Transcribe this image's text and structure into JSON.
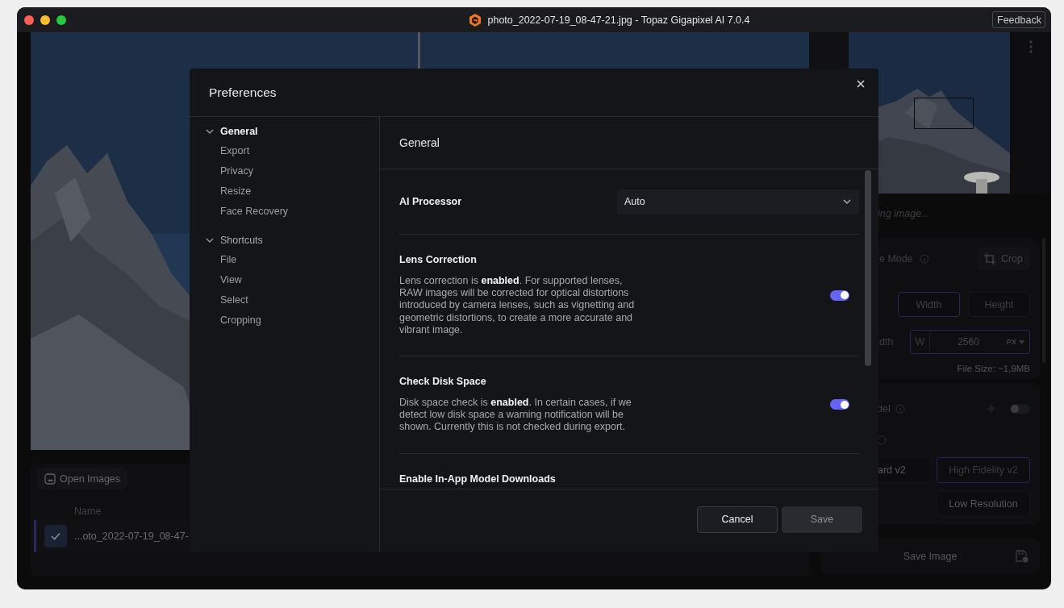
{
  "window": {
    "title": "photo_2022-07-19_08-47-21.jpg - Topaz Gigapixel AI 7.0.4",
    "feedback_button": "Feedback"
  },
  "image_list": {
    "open_button": "Open Images",
    "columns": [
      "Name"
    ],
    "rows": [
      {
        "name": "...oto_2022-07-19_08-47-",
        "checked": true,
        "selected": true
      }
    ]
  },
  "preview": {
    "status": "ing image..."
  },
  "resize_panel": {
    "mode_label": "e Mode",
    "crop_button": "Crop",
    "dimension_tabs": [
      {
        "label": "Width",
        "selected": true
      },
      {
        "label": "Height",
        "selected": false
      }
    ],
    "dimension_label": "dth",
    "field": {
      "prefix": "W",
      "value": "2560",
      "unit": "PX"
    },
    "file_size": "File Size: ~1,9MB"
  },
  "model_panel": {
    "label": "del",
    "toggle_on": false,
    "models": [
      {
        "label": "ard v2",
        "selected": false
      },
      {
        "label": "High Fidelity v2",
        "selected": true
      },
      {
        "label": "Low Resolution",
        "selected": false
      }
    ]
  },
  "save_button": "Save Image",
  "preferences": {
    "title": "Preferences",
    "sidebar": [
      {
        "label": "General",
        "expanded": true,
        "selected": true,
        "children": [
          {
            "label": "Export",
            "selected": false
          },
          {
            "label": "Privacy",
            "selected": false
          },
          {
            "label": "Resize",
            "selected": false
          },
          {
            "label": "Face Recovery",
            "selected": false
          }
        ]
      },
      {
        "label": "Shortcuts",
        "expanded": true,
        "selected": false,
        "children": [
          {
            "label": "File",
            "selected": false
          },
          {
            "label": "View",
            "selected": false
          },
          {
            "label": "Select",
            "selected": false
          },
          {
            "label": "Cropping",
            "selected": false
          }
        ]
      }
    ],
    "section_title": "General",
    "settings": [
      {
        "kind": "select",
        "title": "AI Processor",
        "value": "Auto"
      },
      {
        "kind": "toggle",
        "title": "Lens Correction",
        "description": "Lens correction is **enabled**. For supported lenses, RAW images will be corrected for optical distortions introduced by camera lenses, such as vignetting and geometric distortions, to create a more accurate and vibrant image.",
        "on": true
      },
      {
        "kind": "toggle",
        "title": "Check Disk Space",
        "description": "Disk space check is **enabled**. In certain cases, if we detect low disk space a warning notification will be shown. Currently this is not checked during export.",
        "on": true
      },
      {
        "kind": "label",
        "title": "Enable In-App Model Downloads"
      }
    ],
    "buttons": [
      {
        "label": "Cancel",
        "disabled": false
      },
      {
        "label": "Save",
        "disabled": true
      }
    ]
  }
}
